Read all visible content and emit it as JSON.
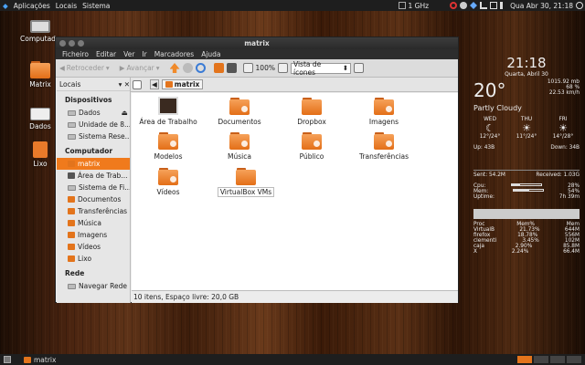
{
  "topbar": {
    "menus": [
      "Aplicações",
      "Locais",
      "Sistema"
    ],
    "cpu": "1 GHz",
    "clock": "Qua Abr 30, 21:18"
  },
  "desktop": {
    "icons": [
      {
        "label": "Computador",
        "name": "computer"
      },
      {
        "label": "Matrix",
        "name": "home-folder"
      },
      {
        "label": "Dados",
        "name": "drive"
      },
      {
        "label": "Lixo",
        "name": "trash"
      }
    ]
  },
  "window": {
    "title": "matrix",
    "menu": [
      "Ficheiro",
      "Editar",
      "Ver",
      "Ir",
      "Marcadores",
      "Ajuda"
    ],
    "toolbar": {
      "back": "Retroceder",
      "forward": "Avançar",
      "zoom": "100%",
      "view": "Vista de ícones"
    },
    "location": "matrix",
    "sidebar": {
      "header": "Locais",
      "sections": [
        {
          "title": "Dispositivos",
          "items": [
            "Dados",
            "Unidade de 8...",
            "Sistema Rese..."
          ]
        },
        {
          "title": "Computador",
          "items": [
            "matrix",
            "Área de Trab...",
            "Sistema de Fi...",
            "Documentos",
            "Transferências",
            "Música",
            "Imagens",
            "Vídeos",
            "Lixo"
          ]
        },
        {
          "title": "Rede",
          "items": [
            "Navegar Rede"
          ]
        }
      ]
    },
    "files": [
      "Área de Trabalho",
      "Documentos",
      "Dropbox",
      "Imagens",
      "Modelos",
      "Música",
      "Público",
      "Transferências",
      "Vídeos",
      "VirtualBox VMs"
    ],
    "status": "10 itens, Espaço livre: 20,0 GB"
  },
  "conky": {
    "time": "21:18",
    "date": "Quarta, Abril 30",
    "temp": "20°",
    "pressure": "1015.92 mb",
    "humidity": "68 %",
    "wind": "22.53 km/h",
    "condition": "Partly Cloudy",
    "forecast": [
      {
        "day": "WED",
        "range": "12°/24°"
      },
      {
        "day": "THU",
        "range": "11°/24°"
      },
      {
        "day": "FRI",
        "range": "14°/28°"
      }
    ],
    "up": "Up: 43B",
    "down": "Down: 34B",
    "sent": "Sent: 54.2M",
    "received": "Received: 1.03G",
    "cpu": {
      "label": "Cpu:",
      "value": "28%",
      "level": 0.28
    },
    "mem": {
      "label": "Mem:",
      "value": "54%",
      "level": 0.54
    },
    "uptime": {
      "label": "Uptime:",
      "value": "7h 39m"
    },
    "proc_header": [
      "Proc",
      "Mem%",
      "Mem"
    ],
    "procs": [
      [
        "VirtualB",
        "21.73%",
        "644M"
      ],
      [
        "firefox",
        "18.78%",
        "556M"
      ],
      [
        "clementi",
        "3.45%",
        "102M"
      ],
      [
        "caja",
        "2.90%",
        "85.8M"
      ],
      [
        "X",
        "2.24%",
        "66.4M"
      ]
    ]
  },
  "taskbar": {
    "item": "matrix"
  }
}
